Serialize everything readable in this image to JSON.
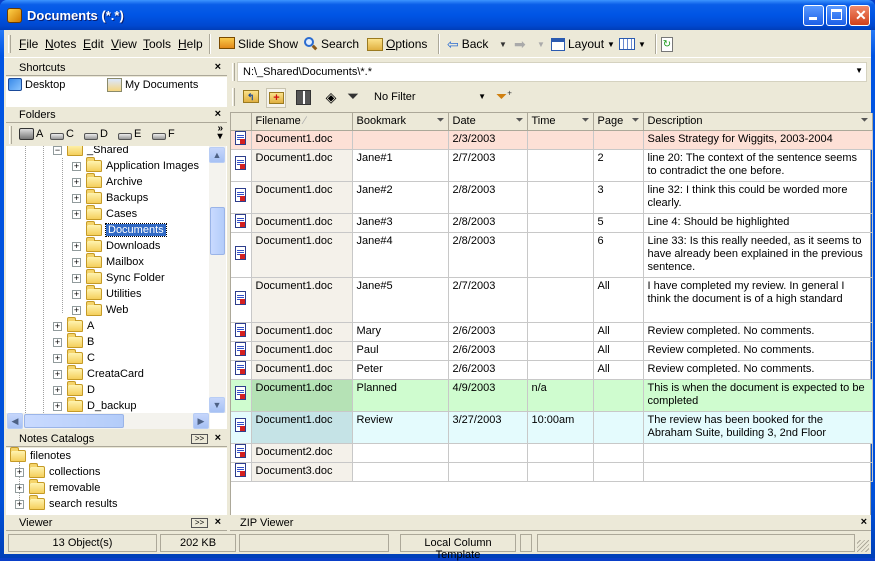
{
  "window": {
    "title": "Documents (*.*)"
  },
  "menu": [
    {
      "label": "File",
      "u": "F",
      "rest": "ile"
    },
    {
      "label": "Notes",
      "u": "N",
      "rest": "otes"
    },
    {
      "label": "Edit",
      "u": "E",
      "rest": "dit"
    },
    {
      "label": "View",
      "u": "V",
      "rest": "iew"
    },
    {
      "label": "Tools",
      "u": "T",
      "rest": "ools"
    },
    {
      "label": "Help",
      "u": "H",
      "rest": "elp"
    }
  ],
  "toolbar": {
    "slide_show": "Slide Show",
    "search": "Search",
    "options": "Options",
    "back": "Back",
    "layout": "Layout"
  },
  "shortcuts": {
    "title": "Shortcuts",
    "items": [
      "Desktop",
      "My Documents"
    ]
  },
  "folders": {
    "title": "Folders",
    "drives": [
      "A",
      "C",
      "D",
      "E",
      "F"
    ],
    "tree": [
      {
        "label": "_Shared",
        "level": 0,
        "expanded": true
      },
      {
        "label": "Application Images",
        "level": 1
      },
      {
        "label": "Archive",
        "level": 1
      },
      {
        "label": "Backups",
        "level": 1
      },
      {
        "label": "Cases",
        "level": 1
      },
      {
        "label": "Documents",
        "level": 1,
        "selected": true,
        "leaf": true
      },
      {
        "label": "Downloads",
        "level": 1
      },
      {
        "label": "Mailbox",
        "level": 1
      },
      {
        "label": "Sync Folder",
        "level": 1
      },
      {
        "label": "Utilities",
        "level": 1
      },
      {
        "label": "Web",
        "level": 1
      },
      {
        "label": "A",
        "level": 0
      },
      {
        "label": "B",
        "level": 0
      },
      {
        "label": "C",
        "level": 0
      },
      {
        "label": "CreataCard",
        "level": 0
      },
      {
        "label": "D",
        "level": 0
      },
      {
        "label": "D_backup",
        "level": 0
      }
    ]
  },
  "notes_catalogs": {
    "title": "Notes Catalogs",
    "root": "filenotes",
    "items": [
      "collections",
      "removable",
      "search results"
    ]
  },
  "viewer": {
    "title": "Viewer"
  },
  "address": {
    "path": "N:\\_Shared\\Documents\\*.*"
  },
  "filter": {
    "value": "No Filter"
  },
  "table": {
    "columns": [
      "Filename",
      "Bookmark",
      "Date",
      "Time",
      "Page",
      "Description"
    ],
    "sort_indicator": "∕",
    "rows": [
      {
        "style": "pink",
        "filename": "Document1.doc",
        "bookmark": "",
        "date": "2/3/2003",
        "time": "",
        "page": "",
        "description": "Sales Strategy for Wiggits, 2003-2004"
      },
      {
        "style": "",
        "filename": "Document1.doc",
        "bookmark": "Jane#1",
        "date": "2/7/2003",
        "time": "",
        "page": "2",
        "description": "line 20: The context of the sentence seems to contradict the one before."
      },
      {
        "style": "",
        "filename": "Document1.doc",
        "bookmark": "Jane#2",
        "date": "2/8/2003",
        "time": "",
        "page": "3",
        "description": "line 32: I think this could be worded more clearly."
      },
      {
        "style": "",
        "filename": "Document1.doc",
        "bookmark": "Jane#3",
        "date": "2/8/2003",
        "time": "",
        "page": "5",
        "description": "Line 4: Should be highlighted"
      },
      {
        "style": "",
        "filename": "Document1.doc",
        "bookmark": "Jane#4",
        "date": "2/8/2003",
        "time": "",
        "page": "6",
        "description": "Line 33: Is this really needed, as it seems to have already been explained in the previous sentence."
      },
      {
        "style": "",
        "filename": "Document1.doc",
        "bookmark": "Jane#5",
        "date": "2/7/2003",
        "time": "",
        "page": "All",
        "description": "I have completed my review. In general I think the document is of a high standard"
      },
      {
        "style": "",
        "filename": "Document1.doc",
        "bookmark": "Mary",
        "date": "2/6/2003",
        "time": "",
        "page": "All",
        "description": "Review completed. No comments."
      },
      {
        "style": "",
        "filename": "Document1.doc",
        "bookmark": "Paul",
        "date": "2/6/2003",
        "time": "",
        "page": "All",
        "description": "Review completed. No comments."
      },
      {
        "style": "",
        "filename": "Document1.doc",
        "bookmark": "Peter",
        "date": "2/6/2003",
        "time": "",
        "page": "All",
        "description": "Review completed. No comments."
      },
      {
        "style": "green",
        "filename": "Document1.doc",
        "bookmark": "Planned",
        "date": "4/9/2003",
        "time": "n/a",
        "page": "",
        "description": "This is when the document is expected to be completed"
      },
      {
        "style": "cyan",
        "filename": "Document1.doc",
        "bookmark": "Review",
        "date": "3/27/2003",
        "time": "10:00am",
        "page": "",
        "description": "The review has been booked for the Abraham Suite, building 3, 2nd Floor"
      },
      {
        "style": "",
        "filename": "Document2.doc",
        "bookmark": "",
        "date": "",
        "time": "",
        "page": "",
        "description": ""
      },
      {
        "style": "",
        "filename": "Document3.doc",
        "bookmark": "",
        "date": "",
        "time": "",
        "page": "",
        "description": ""
      }
    ]
  },
  "zip_viewer": {
    "title": "ZIP Viewer"
  },
  "status": {
    "objects": "13 Object(s)",
    "size": "202 KB",
    "template": "Local Column Template"
  }
}
